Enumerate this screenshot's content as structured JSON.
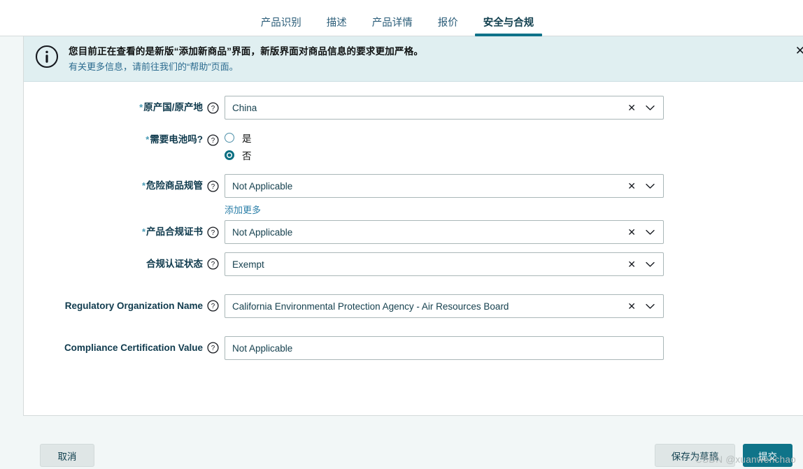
{
  "tabs": [
    {
      "label": "产品识别",
      "active": false
    },
    {
      "label": "描述",
      "active": false
    },
    {
      "label": "产品详情",
      "active": false
    },
    {
      "label": "报价",
      "active": false
    },
    {
      "label": "安全与合规",
      "active": true
    }
  ],
  "alert": {
    "icon": "info-icon",
    "line1": "您目前正在查看的是新版“添加新商品”界面，新版界面对商品信息的要求更加严格。",
    "line2": "有关更多信息，请前往我们的“帮助”页面。",
    "close_label": "✕",
    "bg_color": "#e0eff1",
    "link_color": "#2b6b8f"
  },
  "form": {
    "fields": [
      {
        "name": "country-of-origin",
        "label": "原产国/原产地",
        "required": true,
        "type": "select",
        "value": "China",
        "clear_label": "✕"
      },
      {
        "name": "batteries-required",
        "label": "需要电池吗?",
        "required": true,
        "type": "radio",
        "options": [
          {
            "label": "是",
            "selected": false
          },
          {
            "label": "否",
            "selected": true
          }
        ]
      },
      {
        "name": "dangerous-goods-regulations",
        "label": "危险商品规管",
        "required": true,
        "type": "select",
        "value": "Not Applicable",
        "clear_label": "✕",
        "add_more_label": "添加更多"
      },
      {
        "name": "product-compliance-certificate",
        "label": "产品合规证书",
        "required": true,
        "type": "select",
        "value": "Not Applicable",
        "clear_label": "✕"
      },
      {
        "name": "compliance-certification-status",
        "label": "合规认证状态",
        "required": false,
        "type": "select",
        "value": "Exempt",
        "clear_label": "✕"
      },
      {
        "name": "regulatory-organization-name",
        "label": "Regulatory Organization Name",
        "required": false,
        "type": "select",
        "value": "California Environmental Protection Agency - Air Resources Board",
        "clear_label": "✕"
      },
      {
        "name": "compliance-certification-value",
        "label": "Compliance Certification Value",
        "required": false,
        "type": "text",
        "value": "Not Applicable"
      }
    ],
    "help_icon": "question-mark-icon",
    "chevron_icon": "chevron-down-icon",
    "required_marker": "*"
  },
  "footer": {
    "cancel_label": "取消",
    "save_draft_label": "保存为草稿",
    "submit_label": "提交",
    "submit_color": "#0f7489"
  },
  "watermark": "CSDN @xuanwenchao"
}
